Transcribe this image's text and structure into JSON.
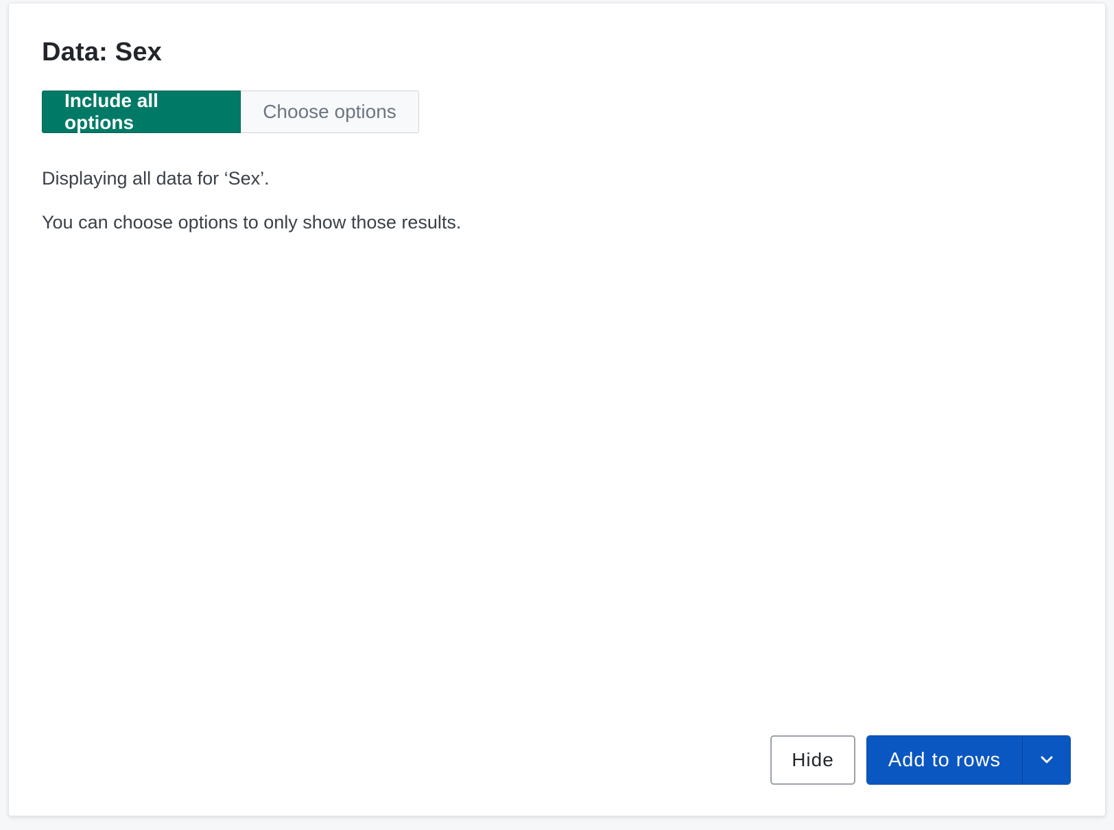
{
  "panel": {
    "title": "Data: Sex"
  },
  "toggle": {
    "include_all": "Include all options",
    "choose": "Choose options",
    "active_color": "#007a66"
  },
  "message": {
    "line1": "Displaying all data for ‘Sex’.",
    "line2": "You can choose options to only show those results."
  },
  "actions": {
    "hide_label": "Hide",
    "add_label": "Add to rows",
    "add_color": "#0b57c2",
    "dropdown_icon": "chevron-down-icon"
  }
}
